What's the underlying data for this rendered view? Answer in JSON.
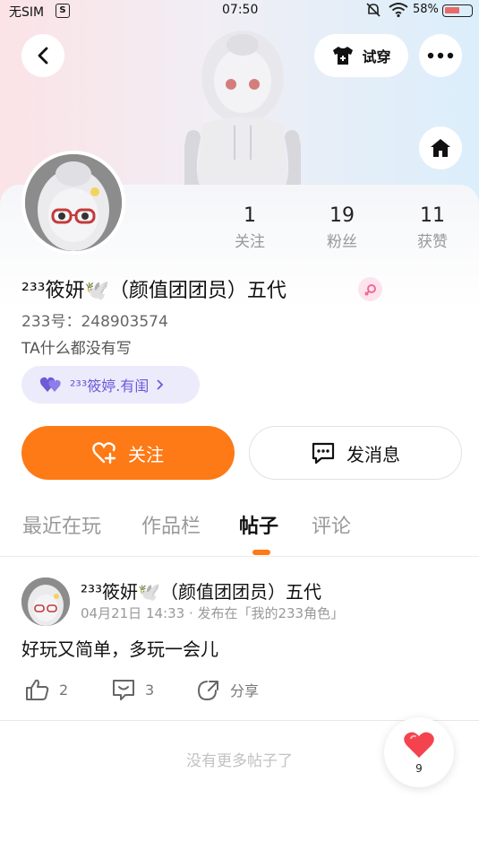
{
  "status_bar": {
    "carrier": "无SIM",
    "time": "07:50",
    "battery_percent": "58%",
    "battery_level": 0.58
  },
  "header": {
    "try_on_label": "试穿"
  },
  "profile": {
    "stats": [
      {
        "value": "1",
        "label": "关注"
      },
      {
        "value": "19",
        "label": "粉丝"
      },
      {
        "value": "11",
        "label": "获赞"
      }
    ],
    "name": "²³³筱妍🕊️（颜值团团员）五代",
    "id_text": "233号：248903574",
    "bio": "TA什么都没有写",
    "relation": "²³³筱婷.有闺",
    "follow_label": "关注",
    "message_label": "发消息"
  },
  "tabs": [
    "最近在玩",
    "作品栏",
    "帖子",
    "评论"
  ],
  "active_tab": 2,
  "post": {
    "author": "²³³筱妍🕊️（颜值团团员）五代",
    "meta": "04月21日 14:33 · 发布在「我的233角色」",
    "body": "好玩又简单，多玩一会儿",
    "likes": "2",
    "comments": "3",
    "share_label": "分享"
  },
  "end_text": "没有更多帖子了",
  "floating_like": {
    "count": "9"
  },
  "colors": {
    "accent": "#fd7a16",
    "relation_bg": "#ecebfc",
    "relation_text": "#6a5bd8",
    "heart": "#f4434f"
  }
}
